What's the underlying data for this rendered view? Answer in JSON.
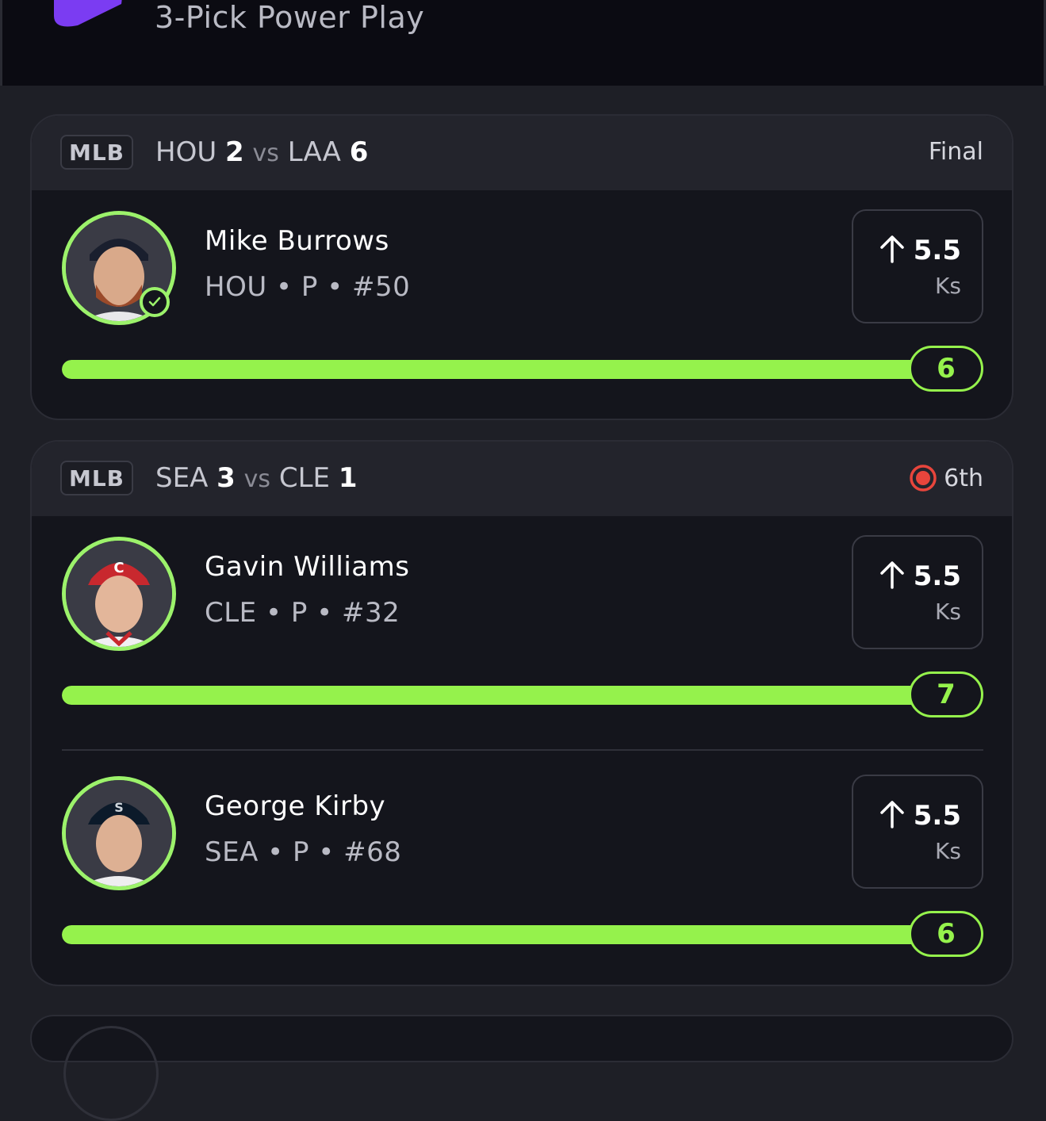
{
  "app": {
    "title": "3-Pick Power Play"
  },
  "colors": {
    "accent": "#95f24c",
    "live": "#e8453c",
    "brand": "#7b3cf2"
  },
  "cards": [
    {
      "league": "MLB",
      "away_team": "HOU",
      "away_score": "2",
      "vs": "vs",
      "home_team": "LAA",
      "home_score": "6",
      "status": "Final",
      "players": [
        {
          "name": "Mike Burrows",
          "meta": "HOU • P • #50",
          "direction": "up",
          "line": "5.5",
          "stat": "Ks",
          "result": "6",
          "progress": 1.0,
          "hit": true
        }
      ]
    },
    {
      "league": "MLB",
      "away_team": "SEA",
      "away_score": "3",
      "vs": "vs",
      "home_team": "CLE",
      "home_score": "1",
      "status": "6th",
      "live": true,
      "players": [
        {
          "name": "Gavin Williams",
          "meta": "CLE • P • #32",
          "direction": "up",
          "line": "5.5",
          "stat": "Ks",
          "result": "7",
          "progress": 1.0
        },
        {
          "name": "George Kirby",
          "meta": "SEA • P • #68",
          "direction": "up",
          "line": "5.5",
          "stat": "Ks",
          "result": "6",
          "progress": 1.0
        }
      ]
    }
  ]
}
